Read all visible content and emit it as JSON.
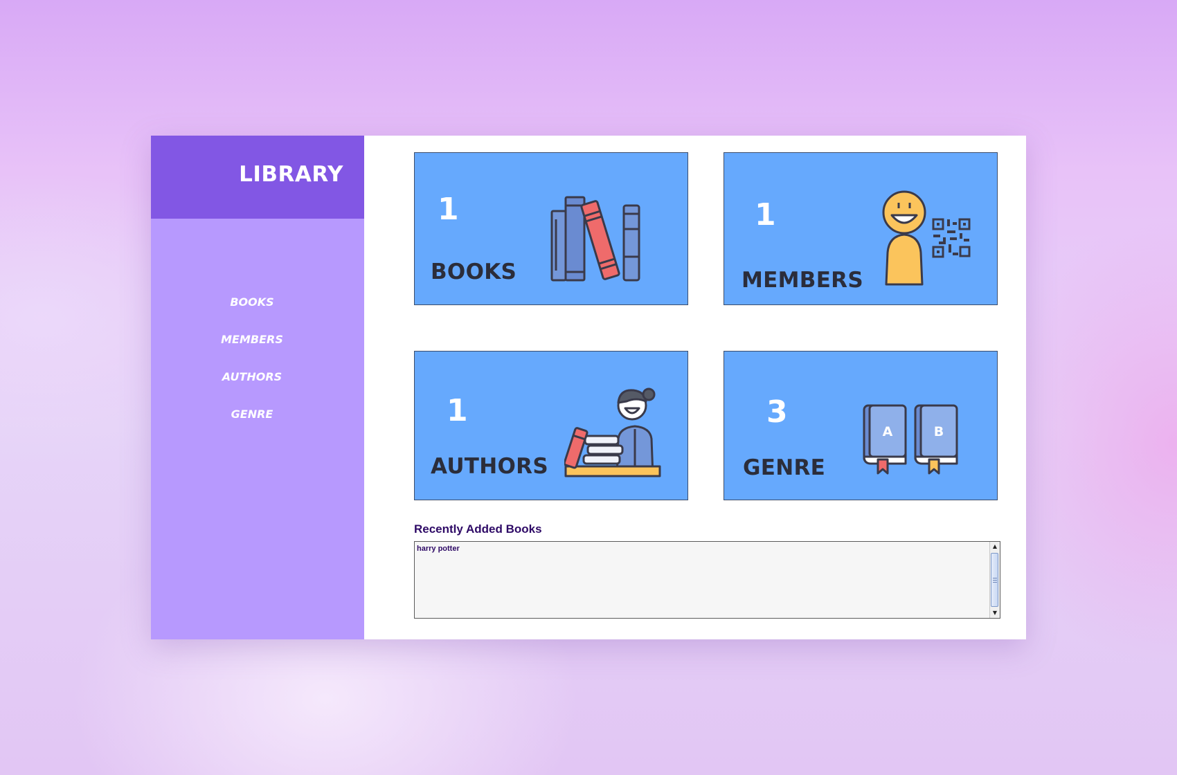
{
  "app": {
    "title": "LIBRARY"
  },
  "sidebar": {
    "items": [
      {
        "label": "BOOKS"
      },
      {
        "label": "MEMBERS"
      },
      {
        "label": "AUTHORS"
      },
      {
        "label": "GENRE"
      }
    ]
  },
  "cards": {
    "books": {
      "count": "1",
      "label": "BOOKS",
      "icon": "books-icon"
    },
    "members": {
      "count": "1",
      "label": "MEMBERS",
      "icon": "member-qr-icon"
    },
    "authors": {
      "count": "1",
      "label": "AUTHORS",
      "icon": "author-icon"
    },
    "genre": {
      "count": "3",
      "label": "GENRE",
      "icon": "genre-books-icon",
      "book_letters": [
        "A",
        "B"
      ]
    }
  },
  "recent": {
    "title": "Recently Added Books",
    "items": [
      "harry potter"
    ]
  },
  "colors": {
    "sidebar": "#b799fe",
    "brand": "#8257e4",
    "card": "#66a9fd",
    "recent_text": "#2e0a66"
  }
}
